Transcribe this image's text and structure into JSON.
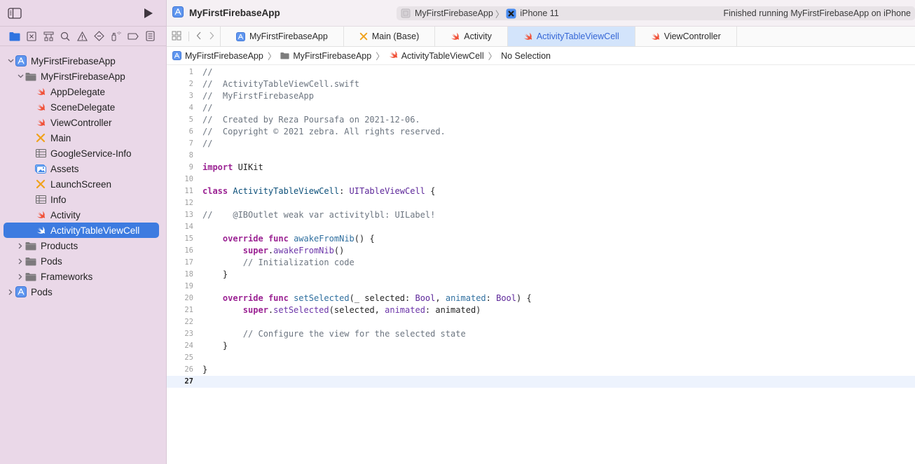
{
  "window": {
    "project_title": "MyFirstFirebaseApp",
    "scheme": {
      "target": "MyFirstFirebaseApp",
      "device": "iPhone 11",
      "status": "Finished running MyFirstFirebaseApp on iPhone"
    }
  },
  "sidebar": {
    "toggle_icon": "sidebar-toggle-icon",
    "run_icon": "play-icon",
    "navigators": [
      {
        "name": "project-navigator",
        "icon": "folder-icon",
        "active": true
      },
      {
        "name": "source-control-navigator",
        "icon": "source-control-icon"
      },
      {
        "name": "symbol-navigator",
        "icon": "hierarchy-icon"
      },
      {
        "name": "find-navigator",
        "icon": "search-icon"
      },
      {
        "name": "issue-navigator",
        "icon": "warning-icon"
      },
      {
        "name": "test-navigator",
        "icon": "diamond-icon"
      },
      {
        "name": "debug-navigator",
        "icon": "spray-icon"
      },
      {
        "name": "breakpoint-navigator",
        "icon": "breakpoint-icon"
      },
      {
        "name": "report-navigator",
        "icon": "report-icon"
      }
    ],
    "tree": [
      {
        "label": "MyFirstFirebaseApp",
        "type": "project",
        "level": 0,
        "expanded": true
      },
      {
        "label": "MyFirstFirebaseApp",
        "type": "folder",
        "level": 1,
        "expanded": true
      },
      {
        "label": "AppDelegate",
        "type": "swift",
        "level": 2
      },
      {
        "label": "SceneDelegate",
        "type": "swift",
        "level": 2
      },
      {
        "label": "ViewController",
        "type": "swift",
        "level": 2
      },
      {
        "label": "Main",
        "type": "storyboard",
        "level": 2
      },
      {
        "label": "GoogleService-Info",
        "type": "plist",
        "level": 2
      },
      {
        "label": "Assets",
        "type": "assets",
        "level": 2
      },
      {
        "label": "LaunchScreen",
        "type": "storyboard",
        "level": 2
      },
      {
        "label": "Info",
        "type": "plist",
        "level": 2
      },
      {
        "label": "Activity",
        "type": "swift",
        "level": 2
      },
      {
        "label": "ActivityTableViewCell",
        "type": "swift",
        "level": 2,
        "selected": true
      },
      {
        "label": "Products",
        "type": "folder",
        "level": 1,
        "expanded": false
      },
      {
        "label": "Pods",
        "type": "folder",
        "level": 1,
        "expanded": false
      },
      {
        "label": "Frameworks",
        "type": "folder",
        "level": 1,
        "expanded": false
      },
      {
        "label": "Pods",
        "type": "project",
        "level": 0,
        "expanded": false
      }
    ]
  },
  "tabs": [
    {
      "label": "MyFirstFirebaseApp",
      "icon": "project-icon"
    },
    {
      "label": "Main (Base)",
      "icon": "storyboard-icon"
    },
    {
      "label": "Activity",
      "icon": "swift-icon"
    },
    {
      "label": "ActivityTableViewCell",
      "icon": "swift-icon",
      "active": true
    },
    {
      "label": "ViewController",
      "icon": "swift-icon"
    }
  ],
  "jumpbar": {
    "project": "MyFirstFirebaseApp",
    "group": "MyFirstFirebaseApp",
    "file": "ActivityTableViewCell",
    "selection": "No Selection"
  },
  "editor": {
    "current_line": 27,
    "lines": [
      "//",
      "//  ActivityTableViewCell.swift",
      "//  MyFirstFirebaseApp",
      "//",
      "//  Created by Reza Poursafa on 2021-12-06.",
      "//  Copyright © 2021 zebra. All rights reserved.",
      "//",
      "",
      "import UIKit",
      "",
      "class ActivityTableViewCell: UITableViewCell {",
      "",
      "//    @IBOutlet weak var activitylbl: UILabel!",
      "",
      "    override func awakeFromNib() {",
      "        super.awakeFromNib()",
      "        // Initialization code",
      "    }",
      "",
      "    override func setSelected(_ selected: Bool, animated: Bool) {",
      "        super.setSelected(selected, animated: animated)",
      "",
      "        // Configure the view for the selected state",
      "    }",
      "",
      "}",
      ""
    ]
  },
  "colors": {
    "sidebar_bg": "#ead8e8",
    "selection": "#3d7be0",
    "active_tab_bg": "#d3e4fb",
    "active_tab_text": "#3466d6",
    "swift_orange": "#f05138",
    "keyword": "#9b2393",
    "comment": "#6c7580"
  }
}
